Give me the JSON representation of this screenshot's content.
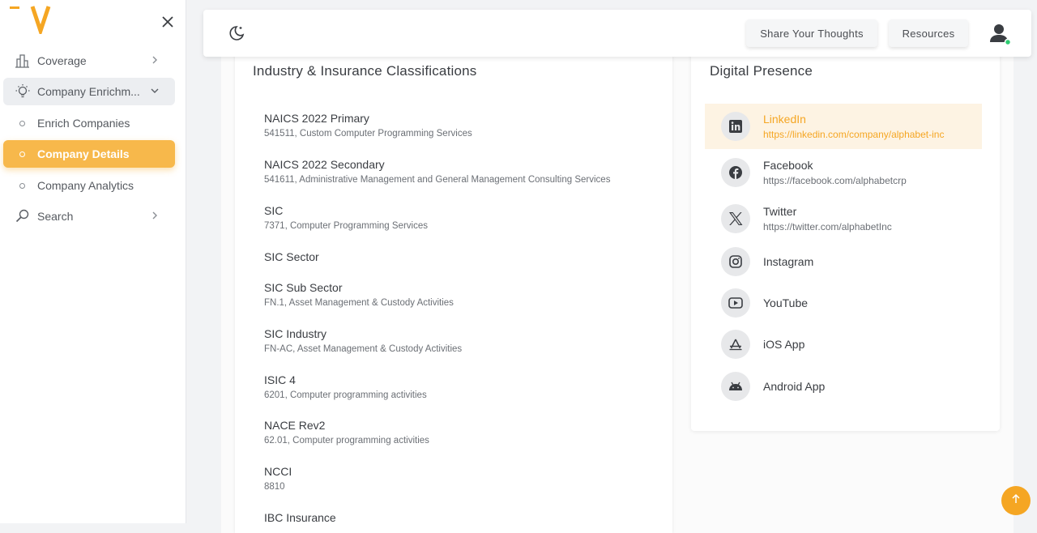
{
  "sidebar": {
    "items": [
      {
        "label": "Coverage",
        "icon": "bar-chart-icon"
      },
      {
        "label": "Company Enrichm...",
        "icon": "lightbulb-icon"
      },
      {
        "label": "Enrich Companies"
      },
      {
        "label": "Company Details"
      },
      {
        "label": "Company Analytics"
      },
      {
        "label": "Search",
        "icon": "search-icon"
      }
    ]
  },
  "header": {
    "share_label": "Share Your Thoughts",
    "resources_label": "Resources"
  },
  "classifications": {
    "title": "Industry & Insurance Classifications",
    "items": [
      {
        "label": "NAICS 2022 Primary",
        "value": "541511, Custom Computer Programming Services"
      },
      {
        "label": "NAICS 2022 Secondary",
        "value": "541611, Administrative Management and General Management Consulting Services"
      },
      {
        "label": "SIC",
        "value": "7371, Computer Programming Services"
      },
      {
        "label": "SIC Sector",
        "value": ""
      },
      {
        "label": "SIC Sub Sector",
        "value": "FN.1, Asset Management & Custody Activities"
      },
      {
        "label": "SIC Industry",
        "value": "FN-AC, Asset Management & Custody Activities"
      },
      {
        "label": "ISIC 4",
        "value": "6201, Computer programming activities"
      },
      {
        "label": "NACE Rev2",
        "value": "62.01, Computer programming activities"
      },
      {
        "label": "NCCI",
        "value": "8810"
      },
      {
        "label": "IBC Insurance",
        "value": ""
      }
    ]
  },
  "digital": {
    "title": "Digital Presence",
    "items": [
      {
        "name": "LinkedIn",
        "url": "https://linkedin.com/company/alphabet-inc",
        "icon": "linkedin-icon"
      },
      {
        "name": "Facebook",
        "url": "https://facebook.com/alphabetcrp",
        "icon": "facebook-icon"
      },
      {
        "name": "Twitter",
        "url": "https://twitter.com/alphabetInc",
        "icon": "x-twitter-icon"
      },
      {
        "name": "Instagram",
        "url": "",
        "icon": "instagram-icon"
      },
      {
        "name": "YouTube",
        "url": "",
        "icon": "youtube-icon"
      },
      {
        "name": "iOS App",
        "url": "",
        "icon": "app-store-icon"
      },
      {
        "name": "Android App",
        "url": "",
        "icon": "android-icon"
      }
    ]
  },
  "colors": {
    "accent": "#f7b84b",
    "accent_text": "#f5a623",
    "status_online": "#2ecc71"
  }
}
